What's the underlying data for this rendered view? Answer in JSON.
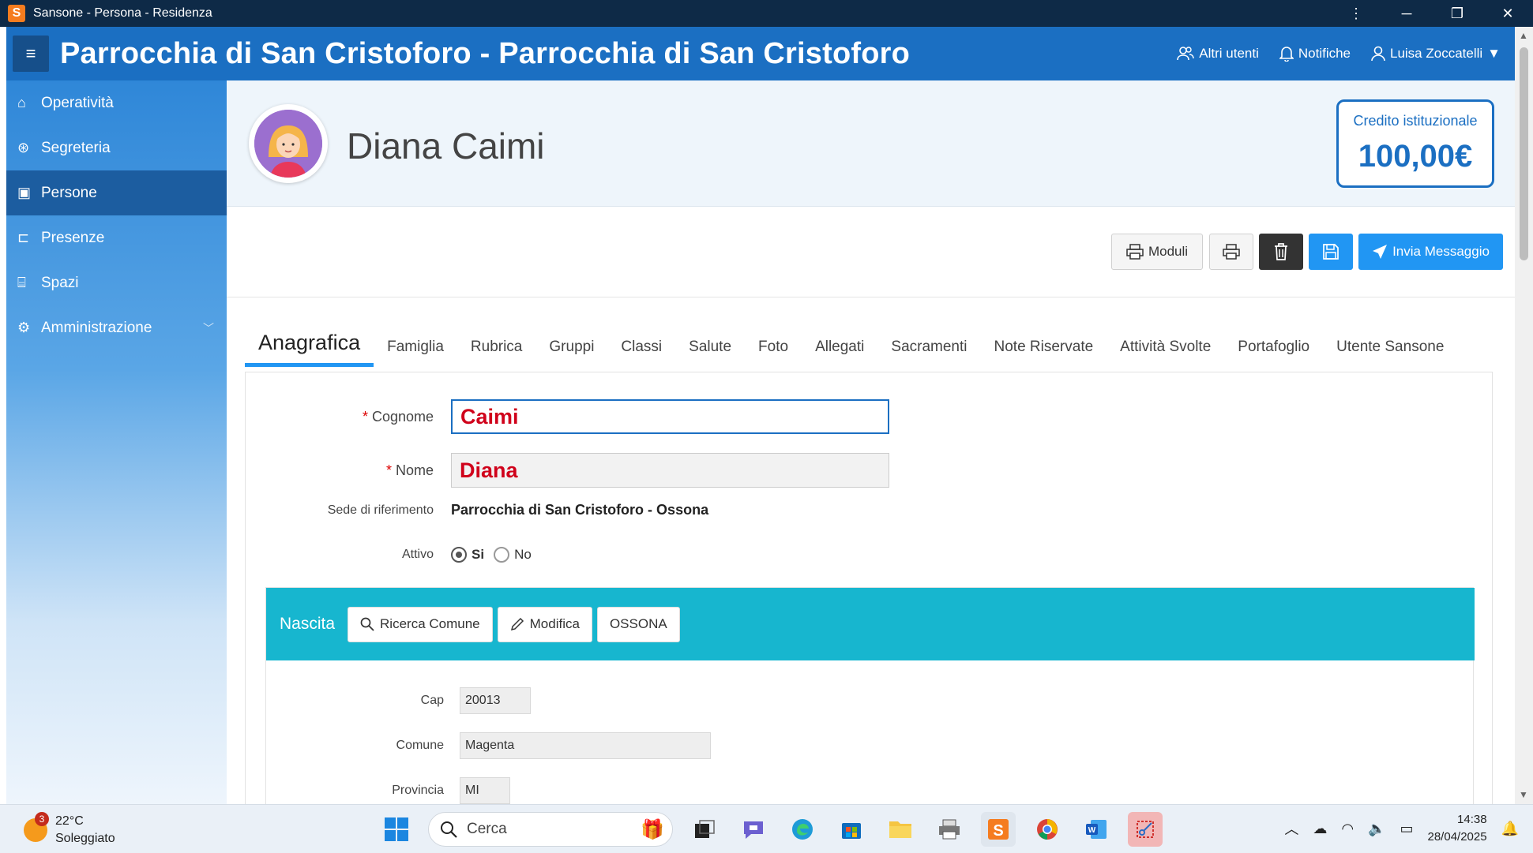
{
  "window": {
    "title": "Sansone - Persona - Residenza",
    "app_letter": "S"
  },
  "header": {
    "title": "Parrocchia di San Cristoforo - Parrocchia di San Cristoforo",
    "other_users": "Altri utenti",
    "notifications": "Notifiche",
    "user": "Luisa Zoccatelli"
  },
  "sidebar": {
    "items": [
      {
        "label": "Operatività",
        "icon": "home-icon"
      },
      {
        "label": "Segreteria",
        "icon": "segreteria-icon"
      },
      {
        "label": "Persone",
        "icon": "id-card-icon",
        "active": true
      },
      {
        "label": "Presenze",
        "icon": "folder-check-icon"
      },
      {
        "label": "Spazi",
        "icon": "building-icon"
      },
      {
        "label": "Amministrazione",
        "icon": "gear-icon"
      }
    ]
  },
  "profile": {
    "name": "Diana Caimi",
    "credit_label": "Credito istituzionale",
    "credit_amount": "100,00€"
  },
  "toolbar": {
    "moduli": "Moduli",
    "send_message": "Invia Messaggio"
  },
  "tabs": [
    "Anagrafica",
    "Famiglia",
    "Rubrica",
    "Gruppi",
    "Classi",
    "Salute",
    "Foto",
    "Allegati",
    "Sacramenti",
    "Note Riservate",
    "Attività Svolte",
    "Portafoglio",
    "Utente Sansone"
  ],
  "form": {
    "cognome_label": "Cognome",
    "cognome_value": "Caimi",
    "nome_label": "Nome",
    "nome_value": "Diana",
    "sede_label": "Sede di riferimento",
    "sede_value": "Parrocchia di San Cristoforo - Ossona",
    "attivo_label": "Attivo",
    "attivo_si": "Si",
    "attivo_no": "No",
    "attivo_selected": "Si"
  },
  "nascita": {
    "title": "Nascita",
    "search_button": "Ricerca Comune",
    "edit_button": "Modifica",
    "comune_button": "OSSONA",
    "cap_label": "Cap",
    "cap_value": "20013",
    "comune_label": "Comune",
    "comune_value": "Magenta",
    "provincia_label": "Provincia",
    "provincia_value": "MI"
  },
  "taskbar": {
    "weather_temp": "22°C",
    "weather_desc": "Soleggiato",
    "weather_badge": "3",
    "search_placeholder": "Cerca",
    "time": "14:38",
    "date": "28/04/2025"
  },
  "colors": {
    "brand_blue": "#1b6fc2",
    "teal": "#17b6cf",
    "required_red": "#d0021b"
  }
}
